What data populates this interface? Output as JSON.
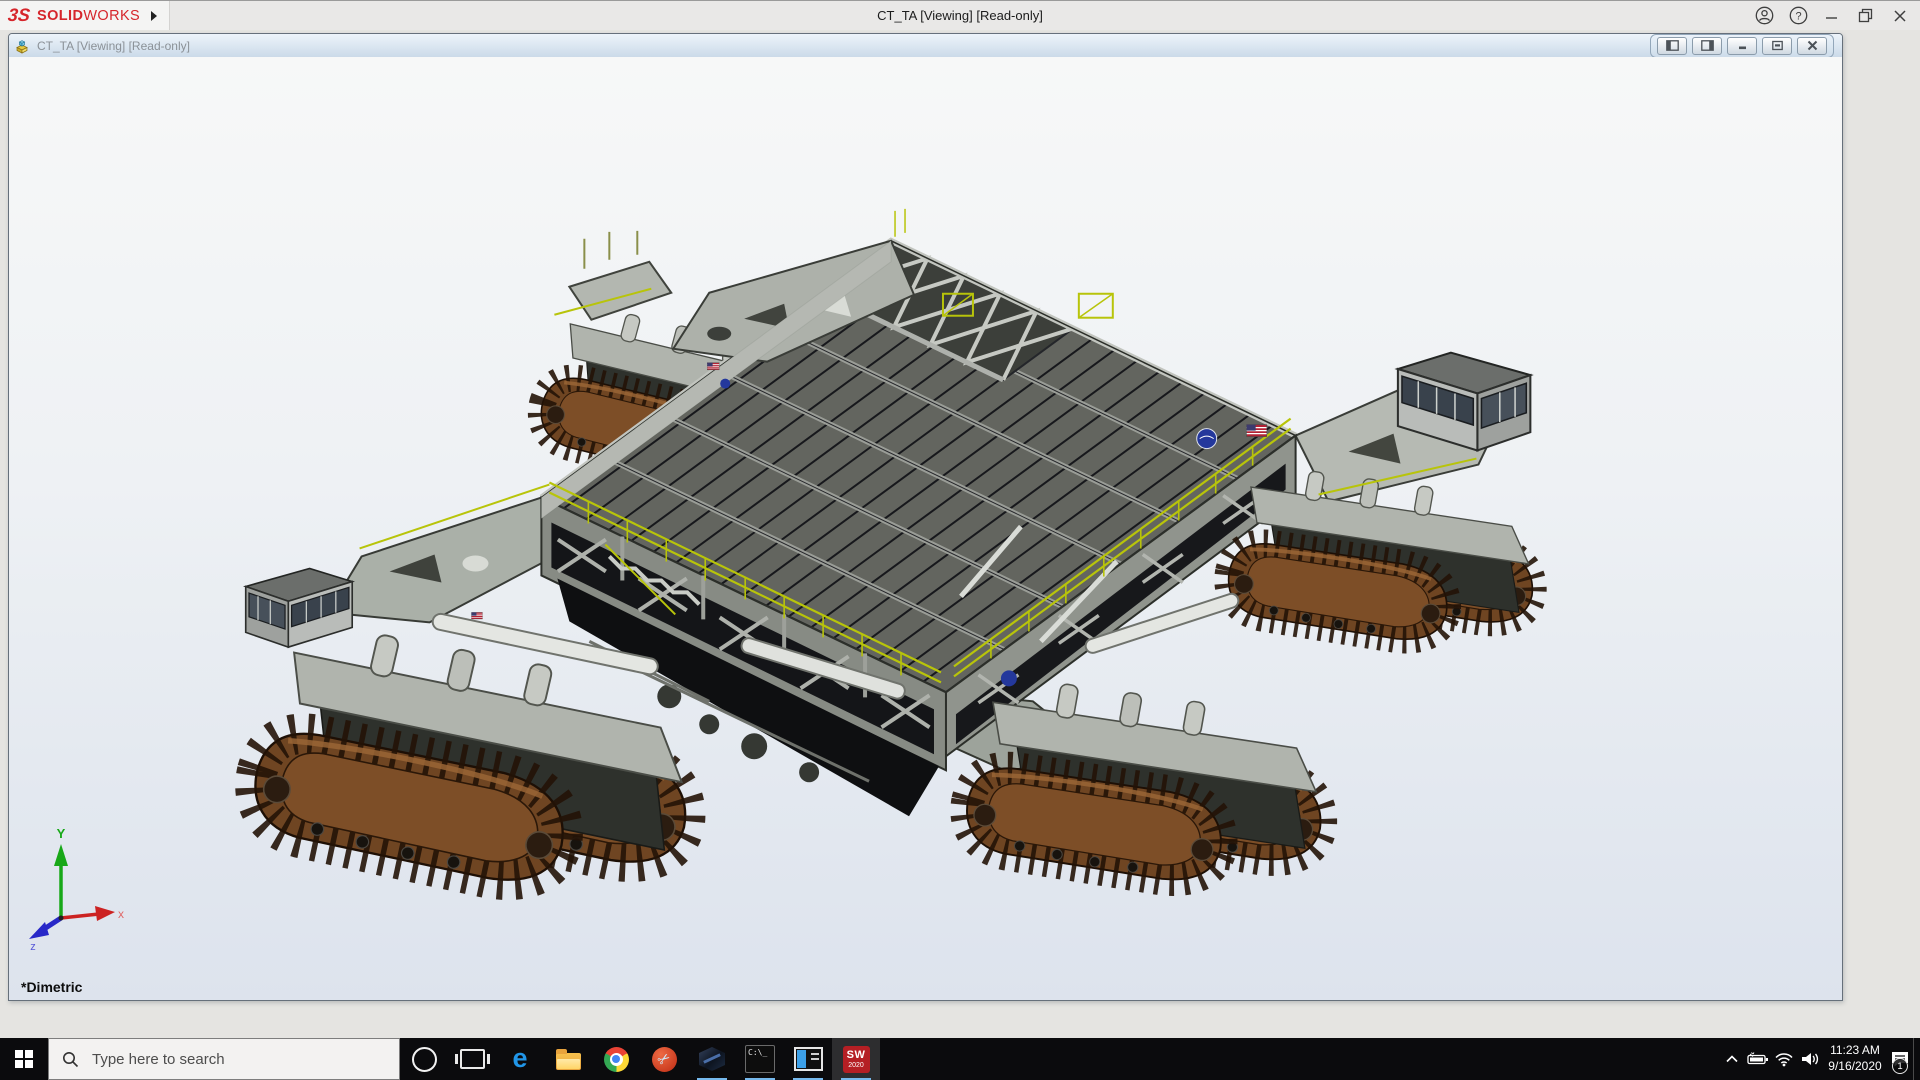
{
  "app": {
    "logo_3s": "3S",
    "logo_solid": "SOLID",
    "logo_works": "WORKS",
    "title": "CT_TA [Viewing] [Read-only]"
  },
  "document": {
    "title": "CT_TA [Viewing] [Read-only]"
  },
  "viewport": {
    "view_orientation": "*Dimetric",
    "axis_labels": {
      "x": "x",
      "y": "Y",
      "z": "z"
    }
  },
  "taskbar": {
    "search_placeholder": "Type here to search",
    "icons": [
      {
        "name": "cortana"
      },
      {
        "name": "task-view"
      },
      {
        "name": "microsoft-edge",
        "glyph": "e"
      },
      {
        "name": "file-explorer"
      },
      {
        "name": "google-chrome"
      },
      {
        "name": "screen-snip-tool",
        "glyph": "✂"
      },
      {
        "name": "hexagon-3d-app"
      },
      {
        "name": "command-prompt",
        "glyph": "C:\\_"
      },
      {
        "name": "media-player-app"
      },
      {
        "name": "solidworks-2020",
        "label_top": "SW",
        "label_bottom": "2020"
      }
    ],
    "tray": {
      "time": "11:23 AM",
      "date": "9/16/2020",
      "notification_badge": "1"
    }
  },
  "colors": {
    "solidworks_red": "#d6252b",
    "taskbar_accent": "#76b9ed",
    "track_brown": "#7a4b26",
    "deck_gray": "#63655f",
    "railing_yellow": "#b8c40a",
    "nasa_blue": "#24389c"
  }
}
